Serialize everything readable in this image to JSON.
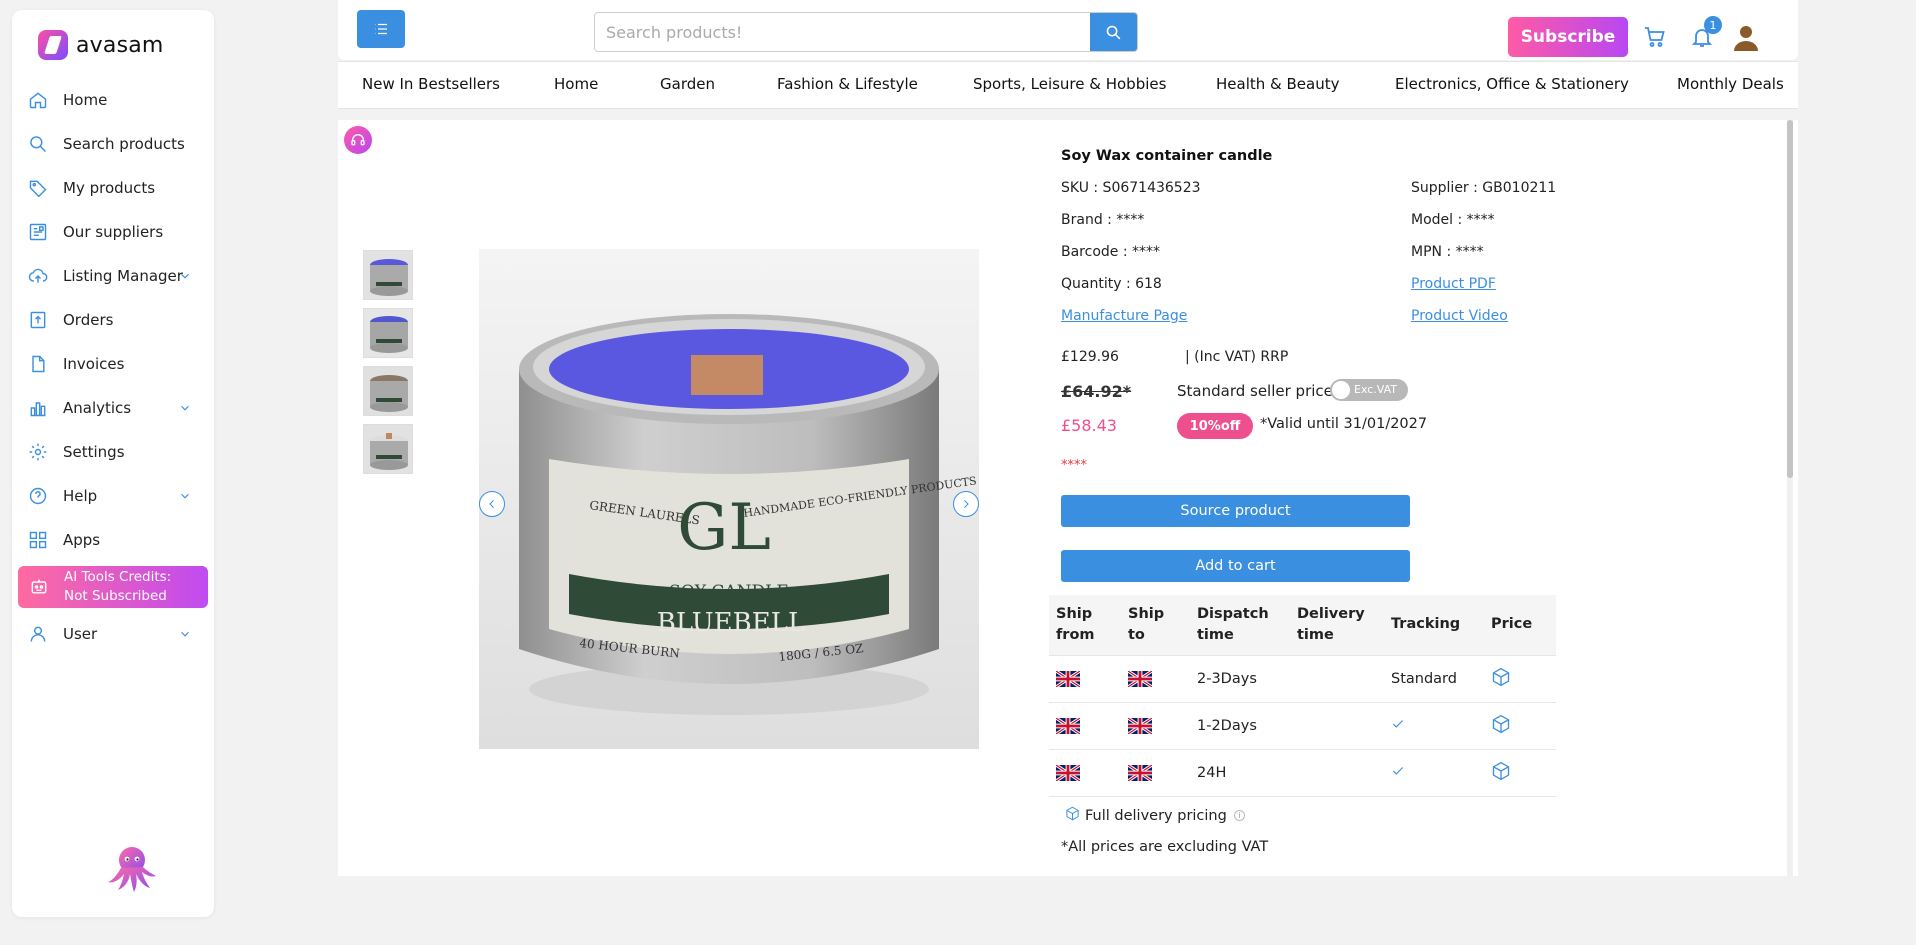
{
  "brand": {
    "name": "avasam"
  },
  "sidebar": {
    "items": [
      {
        "label": "Home",
        "icon": "home-icon"
      },
      {
        "label": "Search products",
        "icon": "search-icon"
      },
      {
        "label": "My products",
        "icon": "tag-icon"
      },
      {
        "label": "Our suppliers",
        "icon": "suppliers-icon"
      },
      {
        "label": "Listing Manager",
        "icon": "upload-cloud-icon",
        "expandable": true
      },
      {
        "label": "Orders",
        "icon": "orders-icon"
      },
      {
        "label": "Invoices",
        "icon": "document-icon"
      },
      {
        "label": "Analytics",
        "icon": "bar-chart-icon",
        "expandable": true
      },
      {
        "label": "Settings",
        "icon": "gear-icon"
      },
      {
        "label": "Help",
        "icon": "help-icon",
        "expandable": true
      },
      {
        "label": "Apps",
        "icon": "apps-grid-icon"
      }
    ],
    "ai_credits": {
      "line1": "AI Tools Credits:",
      "line2": "Not Subscribed"
    },
    "user": {
      "label": "User"
    }
  },
  "header": {
    "search_placeholder": "Search products!",
    "subscribe_label": "Subscribe",
    "notification_count": "1"
  },
  "categories": [
    "New In Bestsellers",
    "Home",
    "Garden",
    "Fashion & Lifestyle",
    "Sports, Leisure & Hobbies",
    "Health & Beauty",
    "Electronics, Office & Stationery",
    "Monthly Deals"
  ],
  "product": {
    "title": "Soy Wax container candle",
    "sku": "SKU : S0671436523",
    "supplier": "Supplier : GB010211",
    "brand": "Brand : ****",
    "model": "Model : ****",
    "barcode": "Barcode : ****",
    "mpn": "MPN : ****",
    "quantity": "Quantity : 618",
    "product_pdf": "Product PDF",
    "manufacture_page": "Manufacture Page",
    "product_video": "Product Video",
    "rrp": "£129.96",
    "rrp_label": "|  (Inc VAT) RRP",
    "old_price": "£64.92*",
    "standard_seller_price_label": "Standard seller price",
    "vat_toggle_label": "Exc.VAT",
    "new_price": "£58.43",
    "discount_badge": "10%off",
    "valid_until": "*Valid until 31/01/2027",
    "hidden_stars": "****",
    "source_button": "Source product",
    "cart_button": "Add to cart",
    "image_label": {
      "brand_left": "GREEN LAURELS",
      "brand_right": "HANDMADE ECO-FRIENDLY PRODUCTS",
      "monogram": "GL",
      "type": "SOY CANDLE",
      "scent": "BLUEBELL",
      "burn": "40 HOUR BURN",
      "weight": "180G / 6.5 OZ"
    }
  },
  "shipping": {
    "headers": [
      "Ship from",
      "Ship to",
      "Dispatch time",
      "Delivery time",
      "Tracking",
      "Price"
    ],
    "rows": [
      {
        "from": "uk-flag",
        "to": "uk-flag",
        "dispatch": "2-3Days",
        "delivery": "",
        "tracking": "Standard",
        "tracking_check": false
      },
      {
        "from": "uk-flag",
        "to": "uk-flag",
        "dispatch": "1-2Days",
        "delivery": "",
        "tracking": "",
        "tracking_check": true
      },
      {
        "from": "uk-flag",
        "to": "uk-flag",
        "dispatch": "24H",
        "delivery": "",
        "tracking": "",
        "tracking_check": true
      }
    ],
    "full_delivery_label": "Full delivery pricing",
    "vat_note": "*All prices are excluding VAT"
  },
  "colors": {
    "accent_blue": "#3b8fe0",
    "pink": "#ee4f8f",
    "gradient_start": "#ff5aa6",
    "gradient_end": "#b847f3"
  }
}
